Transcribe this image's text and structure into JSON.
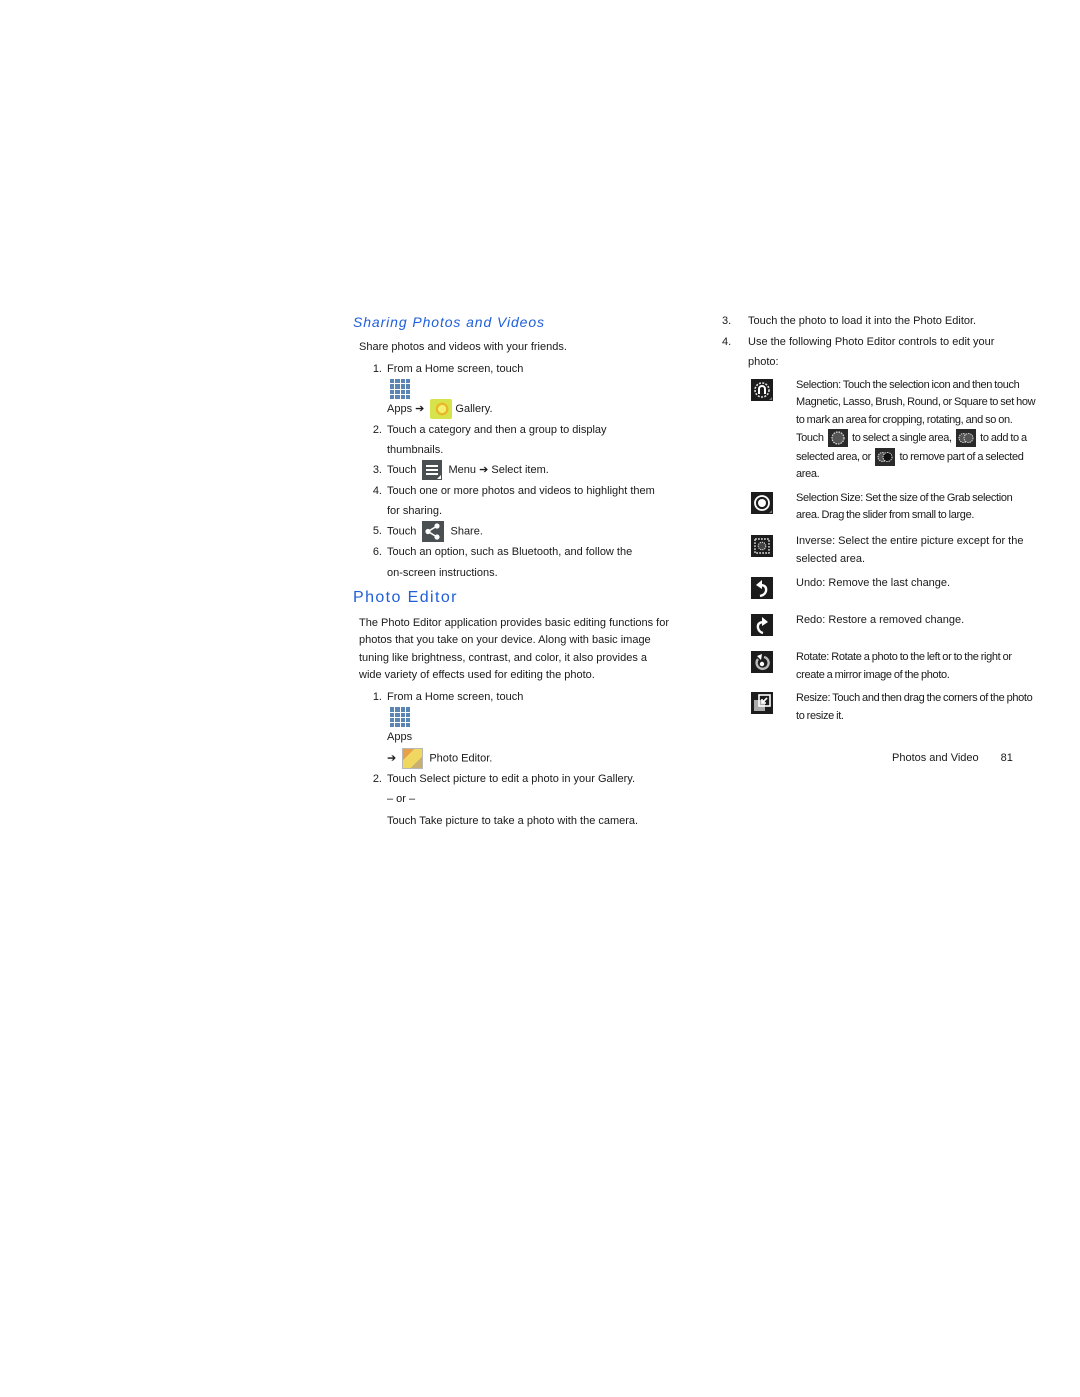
{
  "sharing": {
    "heading": "Sharing Photos and Videos",
    "intro": "Share photos and videos with your friends.",
    "steps": [
      {
        "num": "1.",
        "pre": "From a Home screen, touch",
        "apps_label": "Apps",
        "arrow": "➔",
        "gallery_label": "Gallery."
      },
      {
        "num": "2.",
        "text": "Touch a category and then a group to display",
        "cont": "thumbnails."
      },
      {
        "num": "3.",
        "pre": "Touch",
        "menu_label": "Menu",
        "arrow": "➔",
        "post": "Select item."
      },
      {
        "num": "4.",
        "text": "Touch one or more photos and videos to highlight them",
        "cont": "for sharing."
      },
      {
        "num": "5.",
        "pre": "Touch",
        "post": "Share."
      },
      {
        "num": "6.",
        "text": "Touch an option, such as Bluetooth, and follow the",
        "cont": "on-screen instructions."
      }
    ]
  },
  "photo_editor": {
    "heading": "Photo Editor",
    "intro": "The Photo Editor application provides basic editing functions for photos that you take on your device. Along with basic image tuning like brightness, contrast, and color, it also provides a wide variety of effects used for editing the photo.",
    "steps": [
      {
        "num": "1.",
        "pre": "From a Home screen, touch",
        "apps_label": "Apps",
        "arrow": "➔",
        "editor_label": "Photo Editor."
      },
      {
        "num": "2.",
        "text": "Touch Select picture to edit a photo in your Gallery.",
        "or": "– or –",
        "alt": "Touch Take picture to take a photo with the camera."
      },
      {
        "num": "3.",
        "text": "Touch the photo to load it into the Photo Editor."
      },
      {
        "num": "4.",
        "text": "Use the following Photo Editor controls to edit your photo:"
      }
    ],
    "tools": [
      {
        "icon": "selection-icon",
        "text_a": "Selection: Touch the selection icon and then touch Magnetic, Lasso, Brush, Round, or Square to set how to mark an area for cropping, rotating, and so on. Touch",
        "text_b": "to select a single area,",
        "text_c": "to add to a selected area, or",
        "text_d": "to remove part of a selected area."
      },
      {
        "icon": "selection-size-icon",
        "text": "Selection Size: Set the size of the Grab selection area. Drag the slider from small to large."
      },
      {
        "icon": "inverse-icon",
        "text": "Inverse: Select the entire picture except for the selected area."
      },
      {
        "icon": "undo-icon",
        "text": "Undo: Remove the last change."
      },
      {
        "icon": "redo-icon",
        "text": "Redo: Restore a removed change."
      },
      {
        "icon": "rotate-icon",
        "text": "Rotate: Rotate a photo to the left or to the right or create a mirror image of the photo."
      },
      {
        "icon": "resize-icon",
        "text": "Resize: Touch and then drag the corners of the photo to resize it."
      }
    ]
  },
  "footer": {
    "section": "Photos and Video",
    "page": "81"
  },
  "colors": {
    "heading": "#1f5fd8",
    "text": "#1a1a1a",
    "icon_dark": "#1c1c1c",
    "apps_blue": "#5b86b4"
  }
}
